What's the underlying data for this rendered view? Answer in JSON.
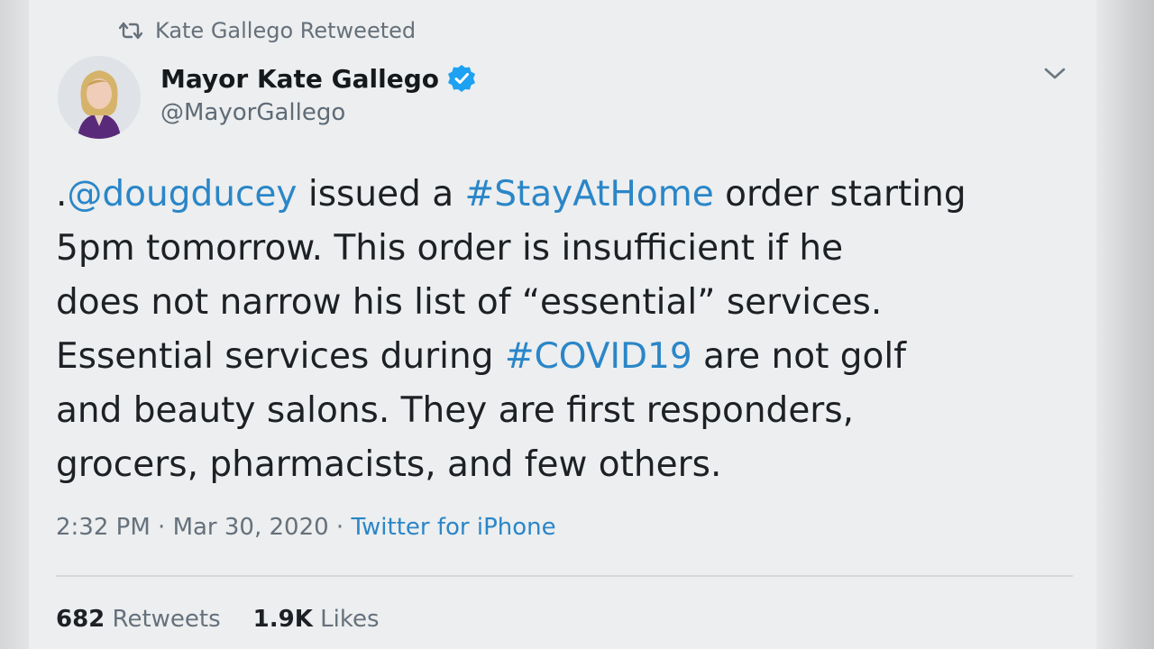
{
  "retweet_banner": {
    "text": "Kate Gallego Retweeted",
    "icon": "retweet-icon"
  },
  "author": {
    "display_name": "Mayor Kate Gallego",
    "handle": "@MayorGallego",
    "verified": true,
    "verified_color": "#1da1f2"
  },
  "tweet": {
    "lines": [
      [
        {
          "t": ".",
          "link": false
        },
        {
          "t": "@dougducey",
          "link": true
        },
        {
          "t": " issued a ",
          "link": false
        },
        {
          "t": "#StayAtHome",
          "link": true
        },
        {
          "t": " order starting",
          "link": false
        }
      ],
      [
        {
          "t": "5pm tomorrow.  This order is insufficient if he",
          "link": false
        }
      ],
      [
        {
          "t": "does not narrow his list of “essential” services.",
          "link": false
        }
      ],
      [
        {
          "t": "Essential services during ",
          "link": false
        },
        {
          "t": "#COVID19",
          "link": true
        },
        {
          "t": " are not golf",
          "link": false
        }
      ],
      [
        {
          "t": "and beauty salons. They are first responders,",
          "link": false
        }
      ],
      [
        {
          "t": "grocers, pharmacists, and few others.",
          "link": false
        }
      ]
    ]
  },
  "meta": {
    "time": "2:32 PM",
    "separator": " · ",
    "date": "Mar 30, 2020",
    "source": "Twitter for iPhone"
  },
  "stats": {
    "retweets_count": "682",
    "retweets_label": "Retweets",
    "likes_count": "1.9K",
    "likes_label": "Likes"
  },
  "colors": {
    "link": "#2a86c8",
    "background": "#eceeef",
    "muted_text": "#65717c"
  }
}
